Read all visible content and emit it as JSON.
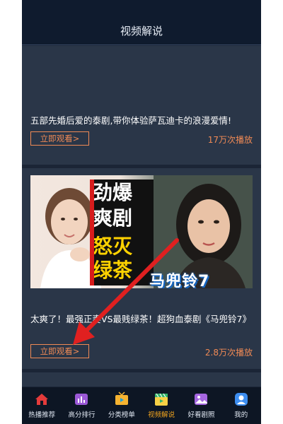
{
  "header": {
    "title": "视频解说"
  },
  "cards": [
    {
      "description": "五部先婚后爱的泰剧,带你体验萨瓦迪卡的浪漫爱情!",
      "watch_label": "立即观看>",
      "plays": "17万次播放"
    },
    {
      "poster": {
        "words": [
          "劲爆",
          "爽剧",
          "怒灭",
          "绿茶"
        ],
        "drama_title": "马兜铃7"
      },
      "description": "太爽了！最强正妻VS最贱绿茶！超狗血泰剧《马兜铃7》",
      "watch_label": "立即观看>",
      "plays": "2.8万次播放"
    }
  ],
  "tabbar": {
    "items": [
      {
        "label": "热播推荐",
        "icon": "home-icon"
      },
      {
        "label": "高分排行",
        "icon": "ranking-chart-icon"
      },
      {
        "label": "分类榜单",
        "icon": "tv-icon"
      },
      {
        "label": "视频解说",
        "icon": "clapperboard-icon",
        "active": true
      },
      {
        "label": "好看剧照",
        "icon": "photo-icon"
      },
      {
        "label": "我的",
        "icon": "user-icon"
      }
    ]
  },
  "colors": {
    "accent": "#f08a55",
    "active_tab": "#f0a31e",
    "background": "#1b2536"
  }
}
